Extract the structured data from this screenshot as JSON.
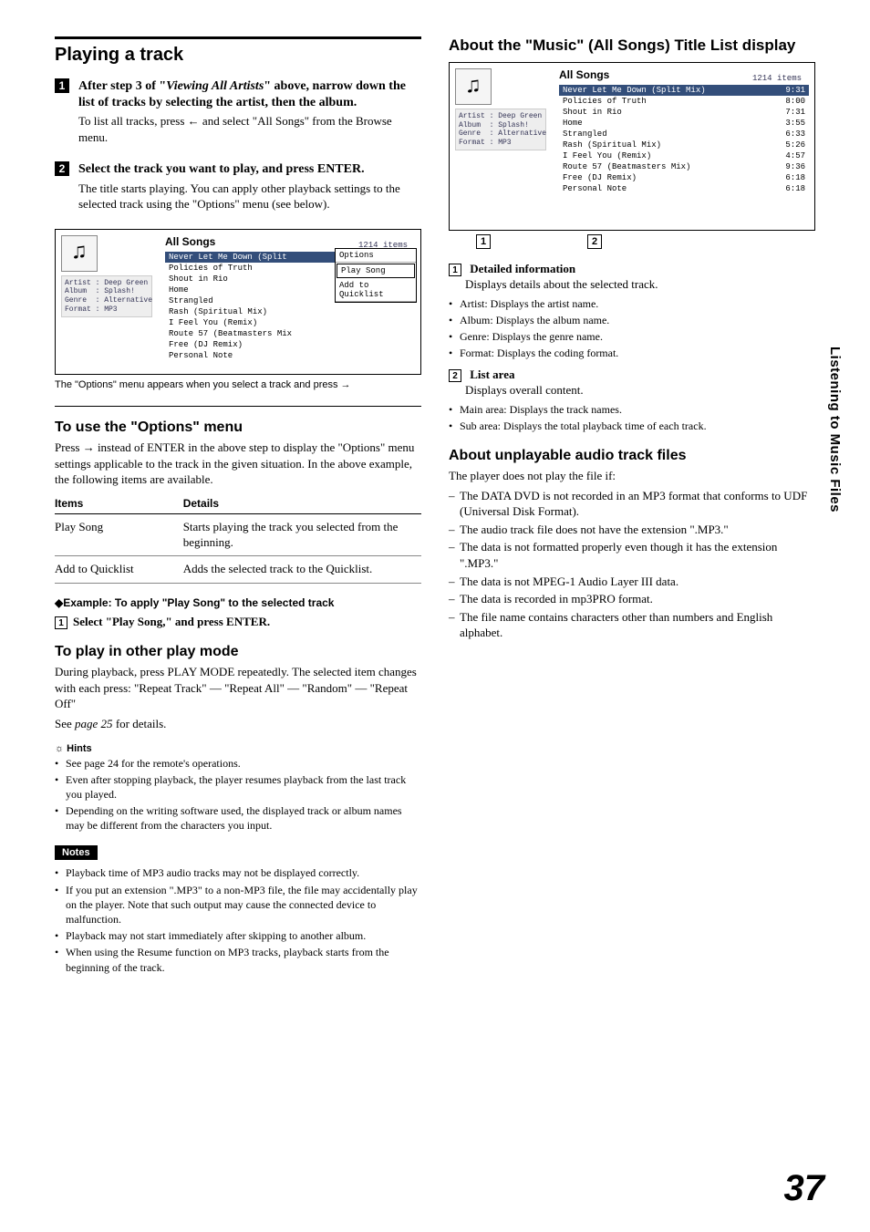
{
  "page_number": "37",
  "side_tab": "Listening to Music Files",
  "left": {
    "heading": "Playing a track",
    "step1": {
      "pre": "After step 3 of \"",
      "ital": "Viewing All Artists",
      "post": "\" above, narrow down the list of tracks by selecting the artist, then the album.",
      "body": "To list all tracks, press ← and select \"All Songs\" from the Browse menu."
    },
    "step2": {
      "head": "Select the track you want to play, and press ENTER.",
      "body": "The title starts playing. You can apply other playback settings to the selected track using the \"Options\" menu (see below)."
    },
    "screenshot1": {
      "title": "All Songs",
      "count": "1214 items",
      "details": "Artist : Deep Green\nAlbum  : Splash!\nGenre  : Alternative\nFormat : MP3",
      "tracks": [
        {
          "n": "Never Let Me Down (Split",
          "t": ""
        },
        {
          "n": "Policies of Truth",
          "t": ""
        },
        {
          "n": "Shout in Rio",
          "t": ""
        },
        {
          "n": "Home",
          "t": ""
        },
        {
          "n": "Strangled",
          "t": ""
        },
        {
          "n": "Rash (Spiritual Mix)",
          "t": ""
        },
        {
          "n": "I Feel You (Remix)",
          "t": ""
        },
        {
          "n": "Route 57 (Beatmasters Mix",
          "t": ""
        },
        {
          "n": "Free (DJ Remix)",
          "t": ""
        },
        {
          "n": "Personal Note",
          "t": ""
        }
      ],
      "popup": {
        "head": "Options",
        "sel": "Play Song",
        "other": "Add to Quicklist"
      },
      "caption": "The \"Options\" menu appears when you select a track and press →"
    },
    "options_heading": "To use the \"Options\" menu",
    "options_intro": "Press → instead of ENTER in the above step to display the \"Options\" menu settings applicable to the track in the given situation. In the above example, the following items are available.",
    "opts_table": {
      "h1": "Items",
      "h2": "Details",
      "rows": [
        {
          "a": "Play Song",
          "b": "Starts playing the track you selected from the beginning."
        },
        {
          "a": "Add to Quicklist",
          "b": "Adds the selected track to the Quicklist."
        }
      ]
    },
    "example_head": "◆Example: To apply \"Play Song\" to the selected track",
    "example_step": "Select \"Play Song,\" and press ENTER.",
    "playmode_heading": "To play in other play mode",
    "playmode_body": "During playback, press PLAY MODE repeatedly. The selected item changes with each press: \"Repeat Track\" — \"Repeat All\" — \"Random\" — \"Repeat Off\"",
    "playmode_see_pre": "See ",
    "playmode_see_ital": "page 25",
    "playmode_see_post": " for details.",
    "hints_head": "Hints",
    "hints": [
      "See page 24 for the remote's operations.",
      "Even after stopping playback, the player resumes playback from the last track you played.",
      "Depending on the writing software used, the displayed track or album names may be different from the characters you input."
    ],
    "notes_head": "Notes",
    "notes": [
      "Playback time of MP3 audio tracks may not be displayed correctly.",
      "If you put an extension \".MP3\" to a non-MP3 file, the file may accidentally play on the player. Note that such output may cause the connected device to malfunction.",
      "Playback may not start immediately after skipping to another album.",
      "When using the Resume function on MP3 tracks, playback starts from the beginning of the track."
    ]
  },
  "right": {
    "heading": "About the \"Music\" (All Songs) Title List display",
    "screenshot2": {
      "title": "All Songs",
      "count": "1214 items",
      "details": "Artist : Deep Green\nAlbum  : Splash!\nGenre  : Alternative\nFormat : MP3",
      "tracks": [
        {
          "n": "Never Let Me Down (Split Mix)",
          "t": "9:31"
        },
        {
          "n": "Policies of Truth",
          "t": "8:00"
        },
        {
          "n": "Shout in Rio",
          "t": "7:31"
        },
        {
          "n": "Home",
          "t": "3:55"
        },
        {
          "n": "Strangled",
          "t": "6:33"
        },
        {
          "n": "Rash (Spiritual Mix)",
          "t": "5:26"
        },
        {
          "n": "I Feel You (Remix)",
          "t": "4:57"
        },
        {
          "n": "Route 57 (Beatmasters Mix)",
          "t": "9:36"
        },
        {
          "n": "Free (DJ Remix)",
          "t": "6:18"
        },
        {
          "n": "Personal Note",
          "t": "6:18"
        }
      ]
    },
    "c1": "1",
    "c2": "2",
    "det_head": "Detailed information",
    "det_body": "Displays details about the selected track.",
    "det_items": [
      "Artist: Displays the artist name.",
      "Album: Displays the album name.",
      "Genre: Displays the genre name.",
      "Format: Displays the coding format."
    ],
    "list_head": "List area",
    "list_body": "Displays overall content.",
    "list_items": [
      "Main area: Displays the track names.",
      "Sub area: Displays the total playback time of each track."
    ],
    "unplay_head": "About unplayable audio track files",
    "unplay_lead": "The player does not play the file if:",
    "unplay_items": [
      "The DATA DVD is not recorded in an MP3 format that conforms to UDF (Universal Disk Format).",
      "The audio track file does not have the extension \".MP3.\"",
      "The data is not formatted properly even though it has the extension \".MP3.\"",
      "The data is not MPEG-1 Audio Layer III data.",
      "The data is recorded in mp3PRO format.",
      "The file name contains characters other than numbers and English alphabet."
    ]
  }
}
